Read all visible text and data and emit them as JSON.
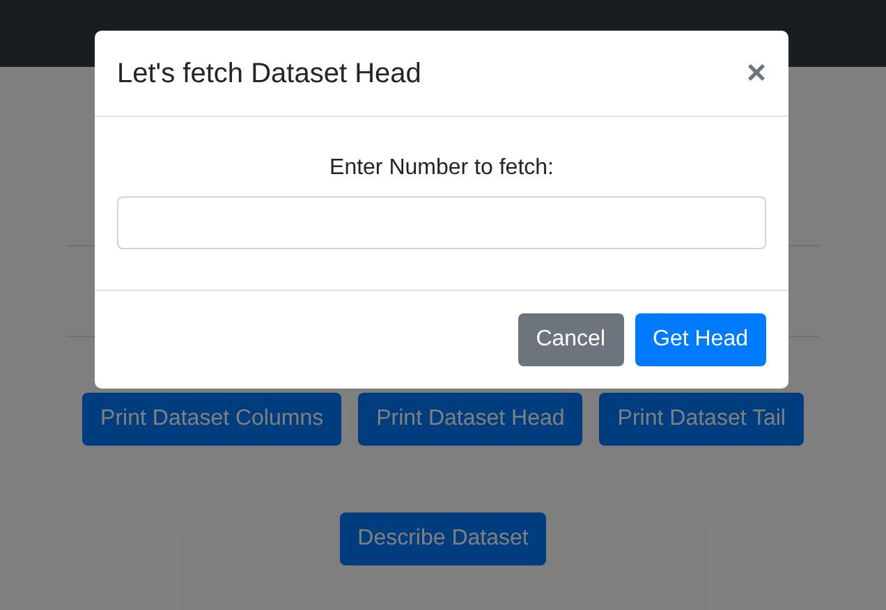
{
  "page": {
    "buttons": [
      "Print Dataset Columns",
      "Print Dataset Head",
      "Print Dataset Tail"
    ],
    "describe_button": "Describe Dataset"
  },
  "modal": {
    "title": "Let's fetch Dataset Head",
    "close": "×",
    "label": "Enter Number to fetch:",
    "buttons": [
      {
        "label": "Cancel",
        "kind": "secondary"
      },
      {
        "label": "Get Head",
        "kind": "primary"
      }
    ]
  }
}
